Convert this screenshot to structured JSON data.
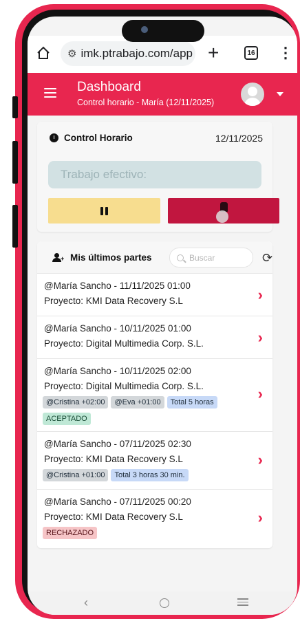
{
  "browser": {
    "url": "imk.ptrabajo.com/app",
    "tabs_count": "16"
  },
  "header": {
    "title": "Dashboard",
    "subtitle": "Control horario - María (12/11/2025)"
  },
  "control": {
    "title": "Control Horario",
    "date": "12/11/2025",
    "trabajo_placeholder": "Trabajo efectivo:"
  },
  "partes": {
    "title": "Mis últimos partes",
    "search_placeholder": "Buscar",
    "items": [
      {
        "line1": "@María Sancho - 11/11/2025 01:00",
        "line2": "Proyecto: KMI Data Recovery S.L",
        "tags": []
      },
      {
        "line1": "@María Sancho - 10/11/2025 01:00",
        "line2": "Proyecto: Digital Multimedia Corp. S.L.",
        "tags": []
      },
      {
        "line1": "@María Sancho - 10/11/2025 02:00",
        "line2": "Proyecto: Digital Multimedia Corp. S.L.",
        "tags": [
          "@Cristina +02:00",
          "@Eva +01:00",
          "Total 5 horas",
          "ACEPTADO"
        ]
      },
      {
        "line1": "@María Sancho - 07/11/2025 02:30",
        "line2": "Proyecto: KMI Data Recovery S.L",
        "tags": [
          "@Cristina +01:00",
          "Total 3 horas 30 min."
        ]
      },
      {
        "line1": "@María Sancho - 07/11/2025 00:20",
        "line2": "Proyecto: KMI Data Recovery S.L",
        "tags": [
          "RECHAZADO"
        ]
      }
    ]
  },
  "colors": {
    "brand": "#e8264f",
    "pause": "#f7dd8f",
    "stop": "#c1163f"
  }
}
